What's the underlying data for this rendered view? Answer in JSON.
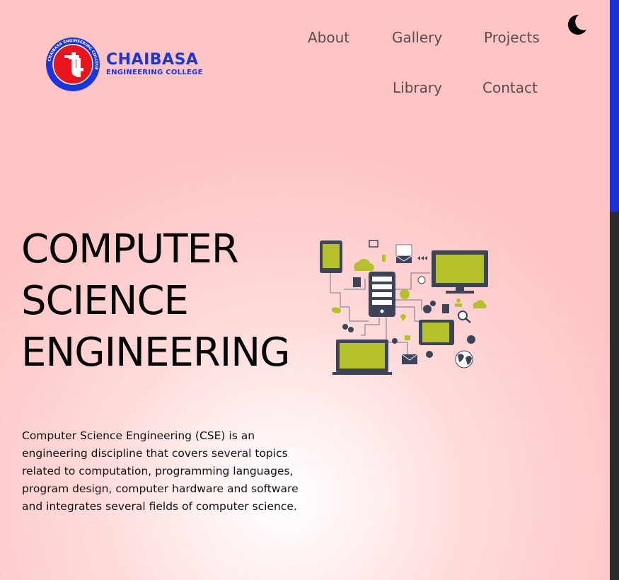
{
  "logo": {
    "name": "CHAIBASA",
    "subtitle": "ENGINEERING COLLEGE",
    "ring_text": "CHAIBASA ENGINEERING COLLEGE",
    "brand_color": "#1a35e0",
    "badge_color": "#e8161c"
  },
  "nav": {
    "items": [
      {
        "label": "About"
      },
      {
        "label": "Gallery"
      },
      {
        "label": "Projects"
      },
      {
        "label": "Library"
      },
      {
        "label": "Contact"
      }
    ],
    "theme_toggle_icon": "moon-icon"
  },
  "hero": {
    "title_lines": [
      "COMPUTER",
      "SCIENCE",
      "ENGINEERING"
    ],
    "description": "Computer Science Engineering (CSE) is an engineering discipline that covers several topics related to computation, programming languages, program design, computer hardware and software and integrates several fields of computer science.",
    "illustration": "network-devices-illustration",
    "accent_color": "#b5c12a",
    "device_color": "#3d4458"
  },
  "scrollbar": {
    "thumb_color": "#1a2fd6"
  }
}
